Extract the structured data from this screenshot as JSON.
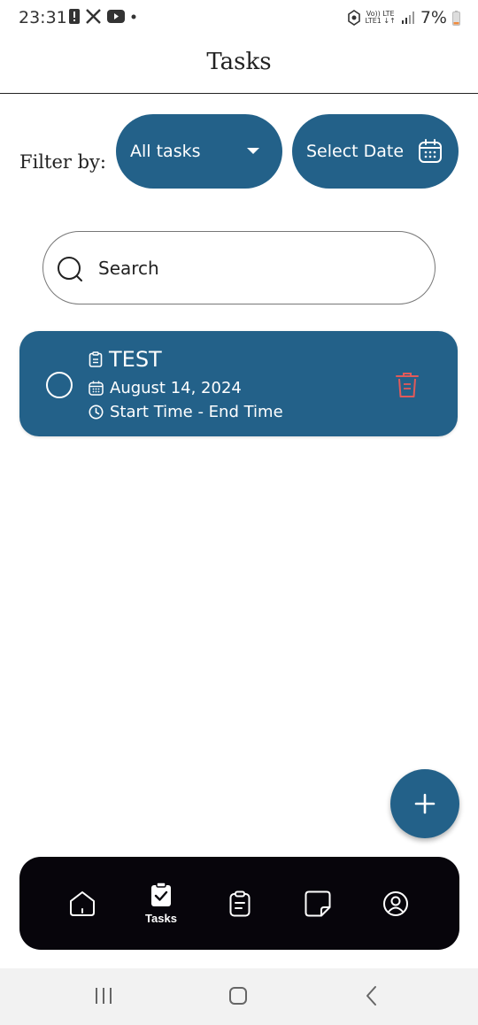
{
  "status_bar": {
    "time": "23:31",
    "left_icons": [
      "alert-icon",
      "x-icon",
      "youtube-icon",
      "dot-icon"
    ],
    "network_top": "Vo)) LTE",
    "network_bottom": "LTE1 ↓↑",
    "battery": "7%"
  },
  "app_bar": {
    "title": "Tasks"
  },
  "filter": {
    "label": "Filter by:",
    "dropdown_value": "All tasks",
    "date_button_label": "Select Date"
  },
  "search": {
    "placeholder": "Search"
  },
  "tasks": [
    {
      "title": "TEST",
      "date": "August 14, 2024",
      "time": "Start Time - End Time"
    }
  ],
  "bottom_nav": {
    "items": [
      {
        "icon": "home-icon",
        "label": ""
      },
      {
        "icon": "tasks-icon",
        "label": "Tasks",
        "active": true
      },
      {
        "icon": "clipboard-icon",
        "label": ""
      },
      {
        "icon": "note-icon",
        "label": ""
      },
      {
        "icon": "profile-icon",
        "label": ""
      }
    ]
  },
  "colors": {
    "primary": "#236189",
    "nav_background": "#07050b",
    "delete": "#e05a5a"
  }
}
